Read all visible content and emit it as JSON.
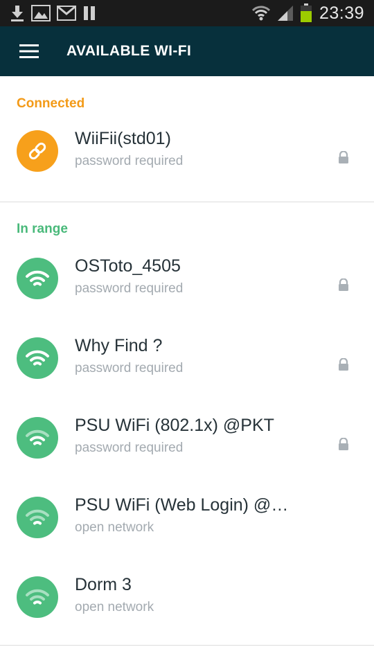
{
  "status_bar": {
    "time": "23:39",
    "left_icons": [
      "download-icon",
      "image-icon",
      "gmail-icon",
      "pause-icon"
    ],
    "right_icons": [
      "wifi-signal-icon",
      "cell-signal-icon",
      "battery-icon"
    ],
    "battery_color": "#9ccc00"
  },
  "app_bar": {
    "title": "AVAILABLE WI-FI",
    "menu_icon": "hamburger-menu-icon",
    "background": "#07303c"
  },
  "sections": {
    "connected": {
      "header": "Connected",
      "color": "#f39a17",
      "networks": [
        {
          "name": "WiiFii(std01)",
          "status": "password required",
          "locked": true,
          "icon": "link-icon"
        }
      ]
    },
    "in_range": {
      "header": "In range",
      "color": "#49b97a",
      "networks": [
        {
          "name": "OSToto_4505",
          "status": "password required",
          "locked": true,
          "icon": "wifi-icon"
        },
        {
          "name": "Why Find ?",
          "status": "password required",
          "locked": true,
          "icon": "wifi-icon"
        },
        {
          "name": "PSU WiFi (802.1x) @PKT",
          "status": "password required",
          "locked": true,
          "icon": "wifi-icon"
        },
        {
          "name": "PSU WiFi (Web Login) @…",
          "status": "open network",
          "locked": false,
          "icon": "wifi-icon"
        },
        {
          "name": "Dorm 3",
          "status": "open network",
          "locked": false,
          "icon": "wifi-icon"
        }
      ]
    }
  }
}
